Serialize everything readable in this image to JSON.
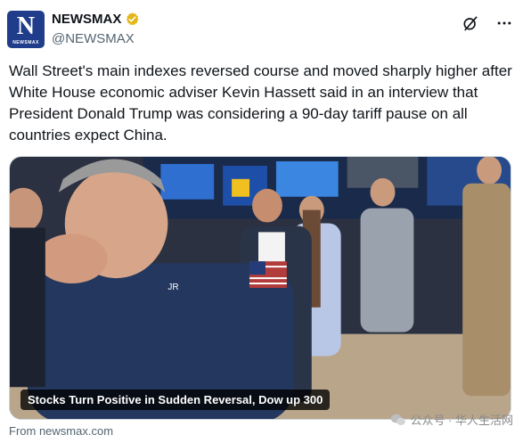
{
  "account": {
    "logo_letter": "N",
    "logo_text": "NEWSMAX",
    "display_name": "NEWSMAX",
    "handle": "@NEWSMAX",
    "verified_icon": "gold-verified-badge-icon"
  },
  "actions": {
    "grok_icon": "grok-icon",
    "more_icon": "more-options-icon"
  },
  "tweet": {
    "text": "Wall Street's main indexes reversed course and moved sharply higher after White House economic adviser Kevin Hassett said in an interview that President Donald Trump was considering a 90-day tariff pause on all countries expect China."
  },
  "card": {
    "caption": "Stocks Turn Positive in Sudden Reversal, Dow up 300",
    "source": "From newsmax.com",
    "photo_badge": "JR"
  },
  "watermark": {
    "text": "公众号 · 华人生活网"
  },
  "colors": {
    "brand_blue": "#1f3d8a",
    "verified_gold": "#e2b719",
    "text_primary": "#0f1419",
    "text_secondary": "#536471"
  }
}
